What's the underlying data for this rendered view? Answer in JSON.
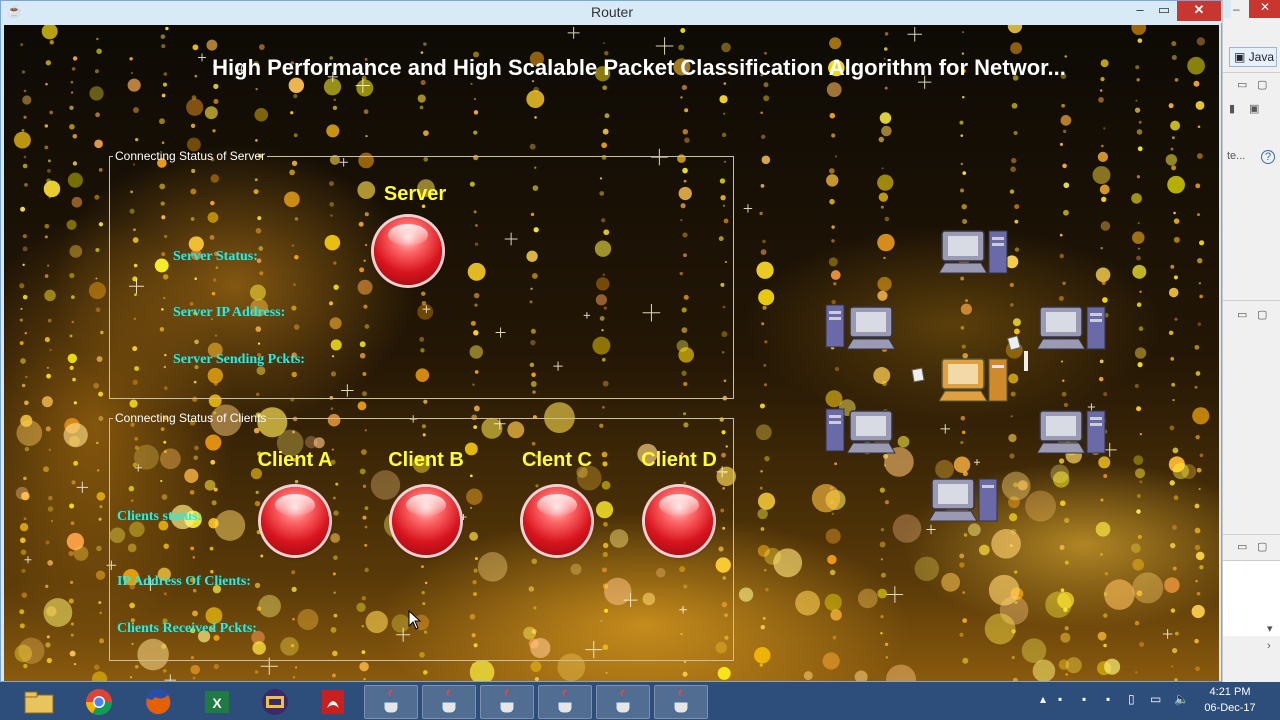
{
  "window": {
    "title": "Router"
  },
  "heading": "High Performance and High Scalable Packet Classification Algorithm for Networ...",
  "server_panel": {
    "legend": "Connecting Status of Server",
    "title": "Server",
    "status_label": "Server Status:",
    "ip_label": "Server IP Address:",
    "sending_label": "Server Sending Pckts:",
    "status_color": "#d8141e"
  },
  "clients_panel": {
    "legend": "Connecting Status of Clients",
    "clients": [
      {
        "name": "Client A"
      },
      {
        "name": "Client B"
      },
      {
        "name": "Clent C"
      },
      {
        "name": "Client D"
      }
    ],
    "status_label": "Clients status:",
    "ip_label": "IP Address Of Clients:",
    "received_label": "Clients Received Pckts:"
  },
  "ide": {
    "perspective_tab": "Java",
    "truncated_text": "te..."
  },
  "taskbar": {
    "apps": [
      "file-explorer-icon",
      "chrome-icon",
      "firefox-icon",
      "excel-icon",
      "java-ee-ide-icon",
      "acrobat-icon",
      "java-icon",
      "java-icon",
      "java-icon",
      "java-icon",
      "java-icon",
      "java-icon"
    ],
    "clock_time": "4:21 PM",
    "clock_date": "06-Dec-17"
  }
}
